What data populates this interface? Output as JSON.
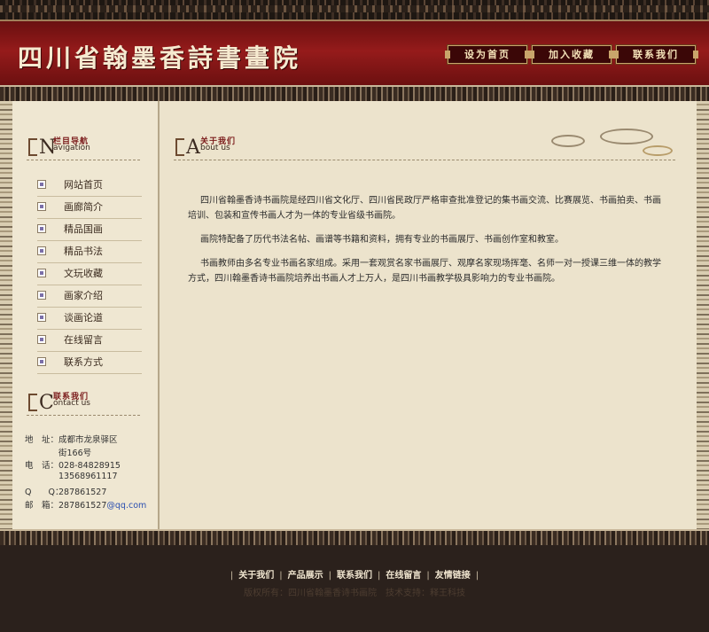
{
  "header": {
    "site_title": "四川省翰墨香詩書畫院",
    "buttons": [
      "设为首页",
      "加入收藏",
      "联系我们"
    ]
  },
  "sidebar": {
    "nav_heading": {
      "letter": "N",
      "zh": "栏目导航",
      "en": "avigation"
    },
    "nav_items": [
      "网站首页",
      "画廊简介",
      "精品国画",
      "精品书法",
      "文玩收藏",
      "画家介绍",
      "谈画论道",
      "在线留言",
      "联系方式"
    ],
    "contact_heading": {
      "letter": "C",
      "zh": "联系我们",
      "en": "ontact us"
    },
    "contact": {
      "address_label": "地　址：",
      "address_line1": "成都市龙泉驿区",
      "address_line2": "街166号",
      "phone_label": "电　话：",
      "phone1": "028-84828915",
      "phone2": "13568961117",
      "qq_label": "Q　　Q：",
      "qq": "287861527",
      "email_label": "邮　箱：",
      "email_user": "287861527",
      "email_domain": "@qq.com"
    }
  },
  "main": {
    "heading": {
      "letter": "A",
      "zh": "关于我们",
      "en": "bout us"
    },
    "paragraphs": [
      "四川省翰墨香诗书画院是经四川省文化厅、四川省民政厅严格审查批准登记的集书画交流、比赛展览、书画拍卖、书画培训、包装和宣传书画人才为一体的专业省级书画院。",
      "画院特配备了历代书法名帖、画谱等书籍和资料，拥有专业的书画展厅、书画创作室和教室。",
      "书画教师由多名专业书画名家组成。采用一套观赏名家书画展厅、观摩名家现场挥毫、名师一对一授课三维一体的教学方式，四川翰墨香诗书画院培养出书画人才上万人，是四川书画教学极具影响力的专业书画院。"
    ]
  },
  "footer": {
    "links": [
      "关于我们",
      "产品展示",
      "联系我们",
      "在线留言",
      "友情链接"
    ],
    "copyright": "版权所有：四川省翰墨香诗书画院　技术支持：释王科技"
  }
}
